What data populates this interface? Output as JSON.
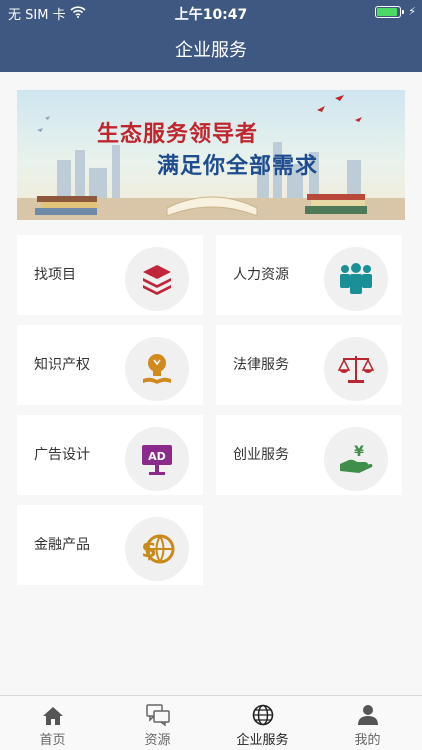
{
  "status_bar": {
    "carrier": "无 SIM 卡",
    "time": "上午10:47",
    "battery_level": 0.9
  },
  "header": {
    "title": "企业服务"
  },
  "banner": {
    "line1": "生态服务领导者",
    "line2": "满足你全部需求"
  },
  "services": [
    {
      "label": "找项目",
      "icon": "layers-icon",
      "color": "#c0263a"
    },
    {
      "label": "人力资源",
      "icon": "people-icon",
      "color": "#1a8f96"
    },
    {
      "label": "知识产权",
      "icon": "lightbulb-book-icon",
      "color": "#d08a1e"
    },
    {
      "label": "法律服务",
      "icon": "scales-icon",
      "color": "#b8262e"
    },
    {
      "label": "广告设计",
      "icon": "ad-board-icon",
      "color": "#8a2b8c"
    },
    {
      "label": "创业服务",
      "icon": "money-hand-icon",
      "color": "#3f8f4a"
    },
    {
      "label": "金融产品",
      "icon": "dollar-globe-icon",
      "color": "#c98a1a"
    }
  ],
  "tabs": [
    {
      "label": "首页",
      "icon": "home-icon"
    },
    {
      "label": "资源",
      "icon": "chat-bubbles-icon"
    },
    {
      "label": "企业服务",
      "icon": "globe-icon",
      "active": true
    },
    {
      "label": "我的",
      "icon": "user-icon"
    }
  ]
}
